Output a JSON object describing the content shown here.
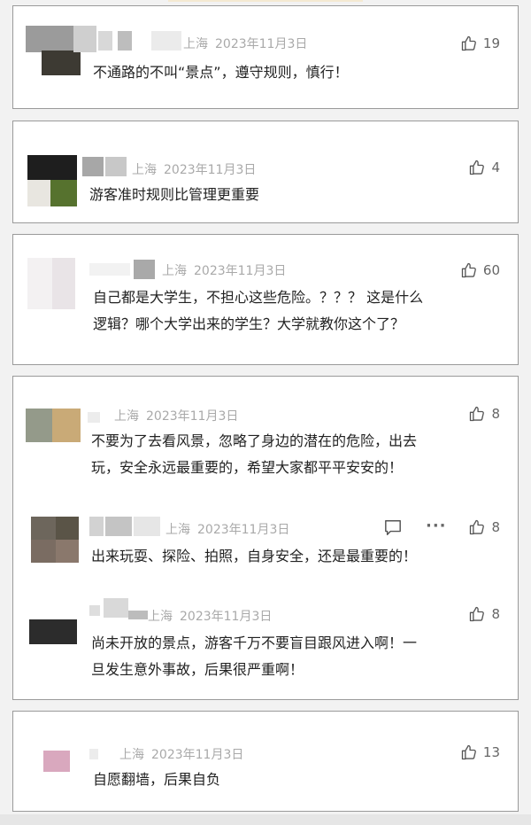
{
  "comments": [
    {
      "location": "上海",
      "date": "2023年11月3日",
      "likes": "19",
      "text": "不通路的不叫“景点”，遵守规则，慎行！"
    },
    {
      "location": "上海",
      "date": "2023年11月3日",
      "likes": "4",
      "text": "游客准时规则比管理更重要"
    },
    {
      "location": "上海",
      "date": "2023年11月3日",
      "likes": "60",
      "text_line1": "自己都是大学生，不担心这些危险。？？？ 这是什么",
      "text_line2": "逻辑？哪个大学出来的学生？大学就教你这个了？"
    },
    {
      "location": "上海",
      "date": "2023年11月3日",
      "likes": "8",
      "text_line1": "不要为了去看风景，忽略了身边的潜在的危险，出去",
      "text_line2": "玩，安全永远最重要的，希望大家都平平安安的！"
    },
    {
      "location": "上海",
      "date": "2023年11月3日",
      "likes": "8",
      "text": "出来玩耍、探险、拍照，自身安全，还是最重要的！"
    },
    {
      "location": "上海",
      "date": "2023年11月3日",
      "likes": "8",
      "text_line1": "尚未开放的景点，游客千万不要盲目跟风进入啊！一",
      "text_line2": "旦发生意外事故，后果很严重啊！"
    },
    {
      "location": "上海",
      "date": "2023年11月3日",
      "likes": "13",
      "text": "自愿翻墙，后果自负"
    }
  ],
  "icons": {
    "like": "thumbs-up-icon",
    "reply": "comment-icon",
    "more": "more-icon"
  },
  "more_glyph": "···",
  "colors": {
    "meta": "#a9a9a9",
    "text": "#222222",
    "border": "#9a9a9a",
    "background": "#f2f2f2"
  }
}
